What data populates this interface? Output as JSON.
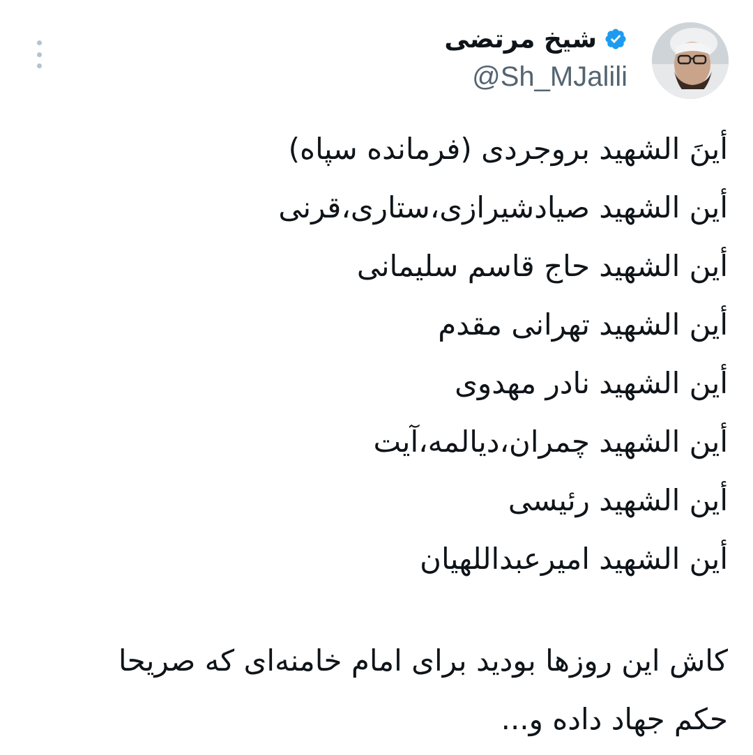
{
  "author": {
    "display_name": "شیخ مرتضی",
    "handle": "@Sh_MJalili",
    "verified": true,
    "verified_color": "#1d9bf0",
    "avatar": "profile-photo"
  },
  "menu": {
    "icon": "more-vertical-icon"
  },
  "tweet": {
    "lines": [
      "أينَ الشهید بروجردی (فرمانده سپاه)",
      "أین الشهید صیادشیرازی،ستاری،قرنی",
      "أین الشهید حاج قاسم سلیمانی",
      "أین الشهید تهرانی مقدم",
      "أین الشهید نادر مهدوی",
      "أین الشهید چمران،دیالمه،آیت",
      "أین الشهید رئیسی",
      "أین الشهید امیرعبداللهیان"
    ],
    "closing_lines": [
      "کاش این روزها بودید برای امام خامنه‌ای که صریحا",
      "حکم جهاد داده و..."
    ]
  },
  "colors": {
    "text": "#0f1419",
    "secondary_text": "#536471",
    "background": "#ffffff"
  }
}
